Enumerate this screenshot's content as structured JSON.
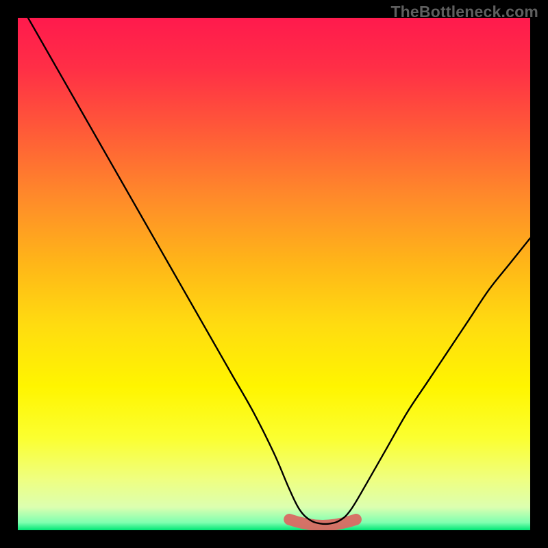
{
  "watermark": "TheBottleneck.com",
  "colors": {
    "background": "#000000",
    "gradient_stops": [
      {
        "offset": 0.0,
        "color": "#ff1a4d"
      },
      {
        "offset": 0.1,
        "color": "#ff2f46"
      },
      {
        "offset": 0.22,
        "color": "#ff5a38"
      },
      {
        "offset": 0.35,
        "color": "#ff8a2a"
      },
      {
        "offset": 0.48,
        "color": "#ffb618"
      },
      {
        "offset": 0.6,
        "color": "#ffdc10"
      },
      {
        "offset": 0.72,
        "color": "#fff500"
      },
      {
        "offset": 0.82,
        "color": "#fbff30"
      },
      {
        "offset": 0.9,
        "color": "#efff80"
      },
      {
        "offset": 0.955,
        "color": "#dcffb0"
      },
      {
        "offset": 0.985,
        "color": "#7fffb0"
      },
      {
        "offset": 1.0,
        "color": "#00e676"
      }
    ],
    "curve": "#000000",
    "highlight": "#d96a63"
  },
  "chart_data": {
    "type": "line",
    "title": "",
    "xlabel": "",
    "ylabel": "",
    "xlim": [
      0,
      100
    ],
    "ylim": [
      0,
      100
    ],
    "series": [
      {
        "name": "bottleneck-curve",
        "x": [
          2,
          6,
          10,
          14,
          18,
          22,
          26,
          30,
          34,
          38,
          42,
          46,
          50,
          53,
          55,
          57,
          59,
          61,
          63,
          65,
          68,
          72,
          76,
          80,
          84,
          88,
          92,
          96,
          100
        ],
        "y": [
          100,
          93,
          86,
          79,
          72,
          65,
          58,
          51,
          44,
          37,
          30,
          23,
          15,
          8,
          4,
          2,
          1.3,
          1.3,
          2,
          4,
          9,
          16,
          23,
          29,
          35,
          41,
          47,
          52,
          57
        ]
      }
    ],
    "highlight_range": {
      "x_start": 53,
      "x_end": 66,
      "y": 1.3,
      "thickness": 2.2
    },
    "annotations": []
  }
}
